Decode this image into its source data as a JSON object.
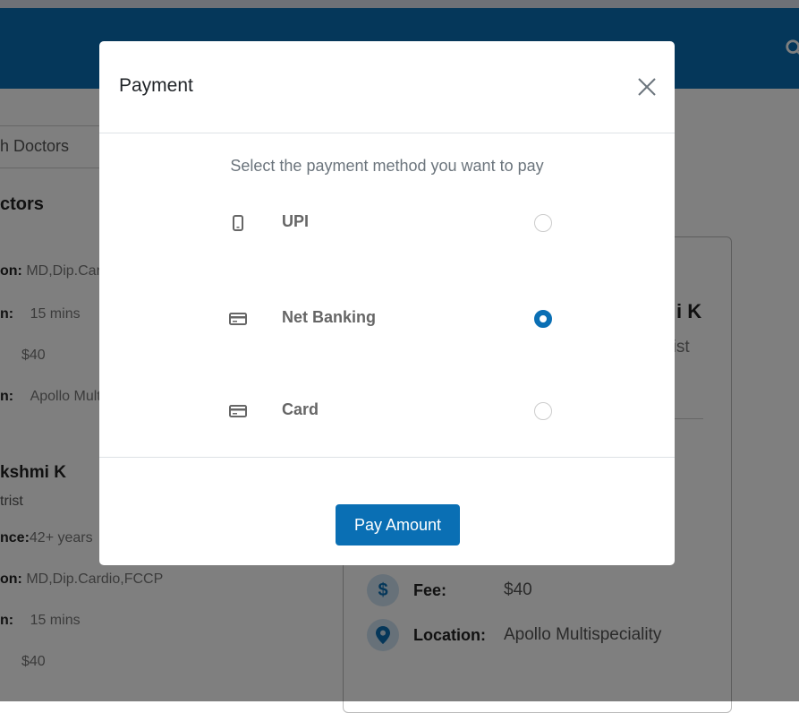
{
  "background": {
    "left_panel": {
      "tab_label": "h Doctors",
      "heading": "ctors",
      "doctor1": {
        "qualification_key": "on:",
        "qualification_value": "MD,Dip.Car",
        "duration_key": "n:",
        "duration_value": "15 mins",
        "fee_value": "$40",
        "location_key": "n:",
        "location_value": "Apollo Mult"
      },
      "doctor2": {
        "name": "kshmi K",
        "specialty": "trist",
        "experience_key": "nce:",
        "experience_value": "42+ years",
        "qualification_key": "on:",
        "qualification_value": "MD,Dip.Cardio,FCCP",
        "duration_key": "n:",
        "duration_value": "15 mins",
        "fee_value": "$40"
      }
    },
    "right_card": {
      "name": "i K",
      "specialty": "trist",
      "fee_label": "Fee:",
      "fee_value": "$40",
      "location_label": "Location:",
      "location_value": "Apollo Multispeciality"
    }
  },
  "modal": {
    "title": "Payment",
    "prompt": "Select the payment method you want to pay",
    "options": [
      {
        "label": "UPI",
        "icon": "mobile-phone-icon",
        "selected": false
      },
      {
        "label": "Net Banking",
        "icon": "bank-card-icon",
        "selected": true
      },
      {
        "label": "Card",
        "icon": "credit-card-icon",
        "selected": false
      }
    ],
    "pay_button": "Pay Amount"
  },
  "colors": {
    "primary": "#0a6fb4",
    "overlay": "rgba(0,0,0,0.5)"
  }
}
